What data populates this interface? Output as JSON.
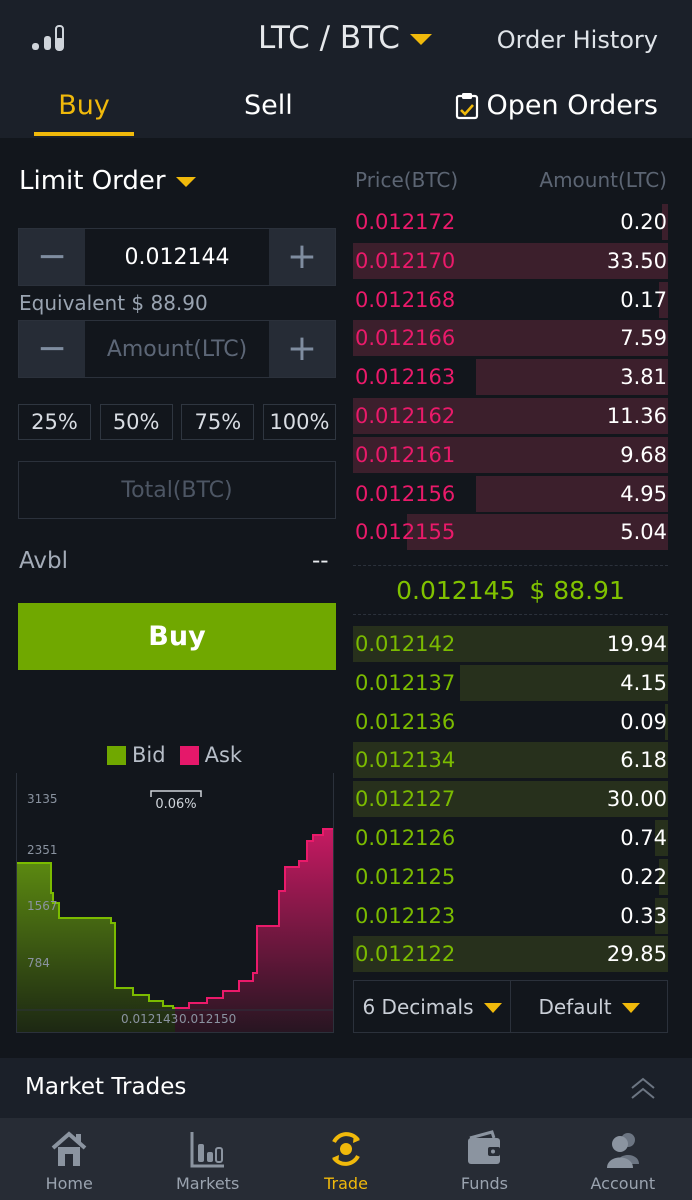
{
  "header": {
    "pair": "LTC / BTC",
    "order_history": "Order History",
    "icon": "depth-chart-icon"
  },
  "tabs": {
    "buy": "Buy",
    "sell": "Sell",
    "open_orders": "Open Orders"
  },
  "form": {
    "order_type": "Limit Order",
    "price_value": "0.012144",
    "equivalent": "Equivalent $ 88.90",
    "amount_placeholder": "Amount(LTC)",
    "percents": [
      "25%",
      "50%",
      "75%",
      "100%"
    ],
    "total_placeholder": "Total(BTC)",
    "avbl_label": "Avbl",
    "avbl_value": "--",
    "buy_label": "Buy"
  },
  "depth_chart": {
    "legend": {
      "bid": "Bid",
      "ask": "Ask"
    },
    "spread": "0.06%",
    "y_ticks": [
      "3135",
      "2351",
      "1567",
      "784"
    ],
    "x_ticks": [
      "0.012143",
      "0.012150"
    ],
    "bid_color": "#70a800",
    "ask_color": "#e5186a"
  },
  "order_book": {
    "header_price": "Price(BTC)",
    "header_amount": "Amount(LTC)",
    "asks": [
      {
        "price": "0.012172",
        "amount": "0.20",
        "depth": 0.02
      },
      {
        "price": "0.012170",
        "amount": "33.50",
        "depth": 1.0
      },
      {
        "price": "0.012168",
        "amount": "0.17",
        "depth": 0.03
      },
      {
        "price": "0.012166",
        "amount": "7.59",
        "depth": 1.0
      },
      {
        "price": "0.012163",
        "amount": "3.81",
        "depth": 0.61
      },
      {
        "price": "0.012162",
        "amount": "11.36",
        "depth": 1.0
      },
      {
        "price": "0.012161",
        "amount": "9.68",
        "depth": 1.0
      },
      {
        "price": "0.012156",
        "amount": "4.95",
        "depth": 0.61
      },
      {
        "price": "0.012155",
        "amount": "5.04",
        "depth": 0.83
      }
    ],
    "last_price": "0.012145",
    "last_usd": "$ 88.91",
    "bids": [
      {
        "price": "0.012142",
        "amount": "19.94",
        "depth": 1.0
      },
      {
        "price": "0.012137",
        "amount": "4.15",
        "depth": 0.66
      },
      {
        "price": "0.012136",
        "amount": "0.09",
        "depth": 0.01
      },
      {
        "price": "0.012134",
        "amount": "6.18",
        "depth": 1.0
      },
      {
        "price": "0.012127",
        "amount": "30.00",
        "depth": 1.0
      },
      {
        "price": "0.012126",
        "amount": "0.74",
        "depth": 0.04
      },
      {
        "price": "0.012125",
        "amount": "0.22",
        "depth": 0.03
      },
      {
        "price": "0.012123",
        "amount": "0.33",
        "depth": 0.04
      },
      {
        "price": "0.012122",
        "amount": "29.85",
        "depth": 1.0
      }
    ],
    "decimals": "6 Decimals",
    "view": "Default"
  },
  "market_trades": {
    "label": "Market Trades"
  },
  "nav": [
    {
      "label": "Home",
      "icon": "home-icon",
      "active": false
    },
    {
      "label": "Markets",
      "icon": "markets-icon",
      "active": false
    },
    {
      "label": "Trade",
      "icon": "trade-icon",
      "active": true
    },
    {
      "label": "Funds",
      "icon": "wallet-icon",
      "active": false
    },
    {
      "label": "Account",
      "icon": "account-icon",
      "active": false
    }
  ],
  "colors": {
    "accent": "#f0b90b",
    "bid": "#7bbb00",
    "ask": "#ea1a6a",
    "buy_button": "#70a800"
  }
}
